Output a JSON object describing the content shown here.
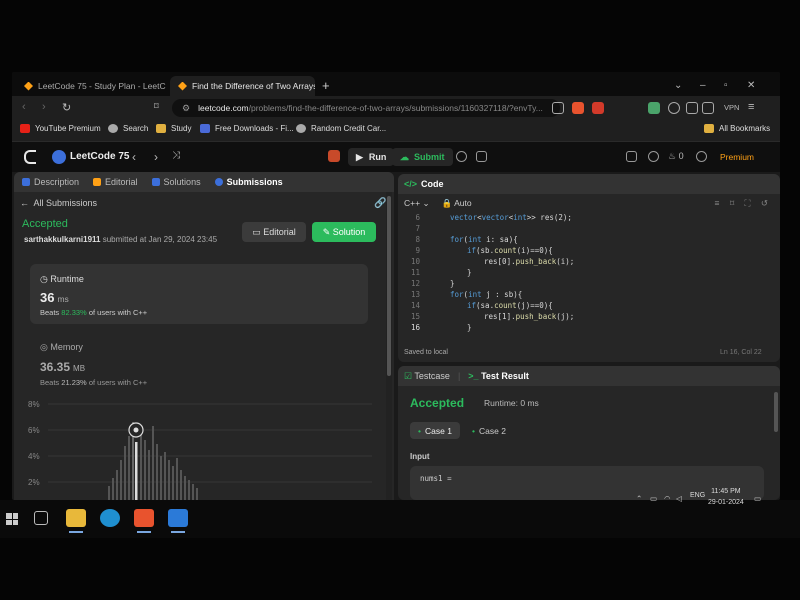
{
  "browser": {
    "tabs": [
      {
        "label": "LeetCode 75 - Study Plan - LeetCode",
        "active": false
      },
      {
        "label": "Find the Difference of Two Arrays",
        "active": true
      }
    ],
    "close_glyph": "×",
    "new_tab_glyph": "+",
    "url_host": "leetcode.com",
    "url_path": "/problems/find-the-difference-of-two-arrays/submissions/1160327118/?envTy...",
    "vpn_label": "VPN",
    "bookmarks": [
      {
        "label": "YouTube Premium",
        "icon": "youtube-icon"
      },
      {
        "label": "Search",
        "icon": "search-icon"
      },
      {
        "label": "Study",
        "icon": "folder-icon"
      },
      {
        "label": "Free Downloads - Fi...",
        "icon": "bookmark-icon"
      },
      {
        "label": "Random Credit Car...",
        "icon": "globe-icon"
      }
    ],
    "all_bookmarks": "All Bookmarks"
  },
  "lc_nav": {
    "title": "LeetCode 75",
    "run_label": "Run",
    "submit_label": "Submit",
    "streak": "0",
    "premium_label": "Premium"
  },
  "left": {
    "tabs": [
      "Description",
      "Editorial",
      "Solutions",
      "Submissions"
    ],
    "all_submissions": "All Submissions",
    "status": "Accepted",
    "username": "sarthakkulkarni1911",
    "submitted_text": "submitted at Jan 29, 2024 23:45",
    "editorial_btn": "Editorial",
    "solution_btn": "Solution",
    "runtime": {
      "label": "Runtime",
      "value": "36",
      "unit": "ms",
      "beats_prefix": "Beats",
      "beats_pct": "82.33%",
      "beats_suffix": "of users with C++"
    },
    "memory": {
      "label": "Memory",
      "value": "36.35",
      "unit": "MB",
      "beats_prefix": "Beats",
      "beats_pct": "21.23%",
      "beats_suffix": "of users with C++"
    },
    "chart_ticks": [
      "8%",
      "6%",
      "4%",
      "2%"
    ]
  },
  "code": {
    "header": "Code",
    "language": "C++",
    "mode": "Auto",
    "lines": [
      {
        "n": "6",
        "indent": 0,
        "text": "vector<vector<int>> res(2);"
      },
      {
        "n": "7",
        "indent": 0,
        "text": ""
      },
      {
        "n": "8",
        "indent": 0,
        "text": "for(int i: sa){"
      },
      {
        "n": "9",
        "indent": 1,
        "text": "if(sb.count(i)==0){"
      },
      {
        "n": "10",
        "indent": 2,
        "text": "res[0].push_back(i);"
      },
      {
        "n": "11",
        "indent": 1,
        "text": "}"
      },
      {
        "n": "12",
        "indent": 0,
        "text": "}"
      },
      {
        "n": "13",
        "indent": 0,
        "text": "for(int j : sb){"
      },
      {
        "n": "14",
        "indent": 1,
        "text": "if(sa.count(j)==0){"
      },
      {
        "n": "15",
        "indent": 2,
        "text": "res[1].push_back(j);"
      },
      {
        "n": "16",
        "indent": 1,
        "text": "}"
      }
    ],
    "saved": "Saved to local",
    "position": "Ln 16, Col 22"
  },
  "test": {
    "tab_testcase": "Testcase",
    "tab_result": "Test Result",
    "status": "Accepted",
    "runtime": "Runtime: 0 ms",
    "case1": "Case 1",
    "case2": "Case 2",
    "input_label": "Input",
    "input_value": "nums1 ="
  },
  "taskbar": {
    "lang": "ENG",
    "time": "11:45 PM",
    "date": "29-01-2024"
  },
  "colors": {
    "accent_green": "#2cbb5d",
    "premium_orange": "#ffa116"
  }
}
